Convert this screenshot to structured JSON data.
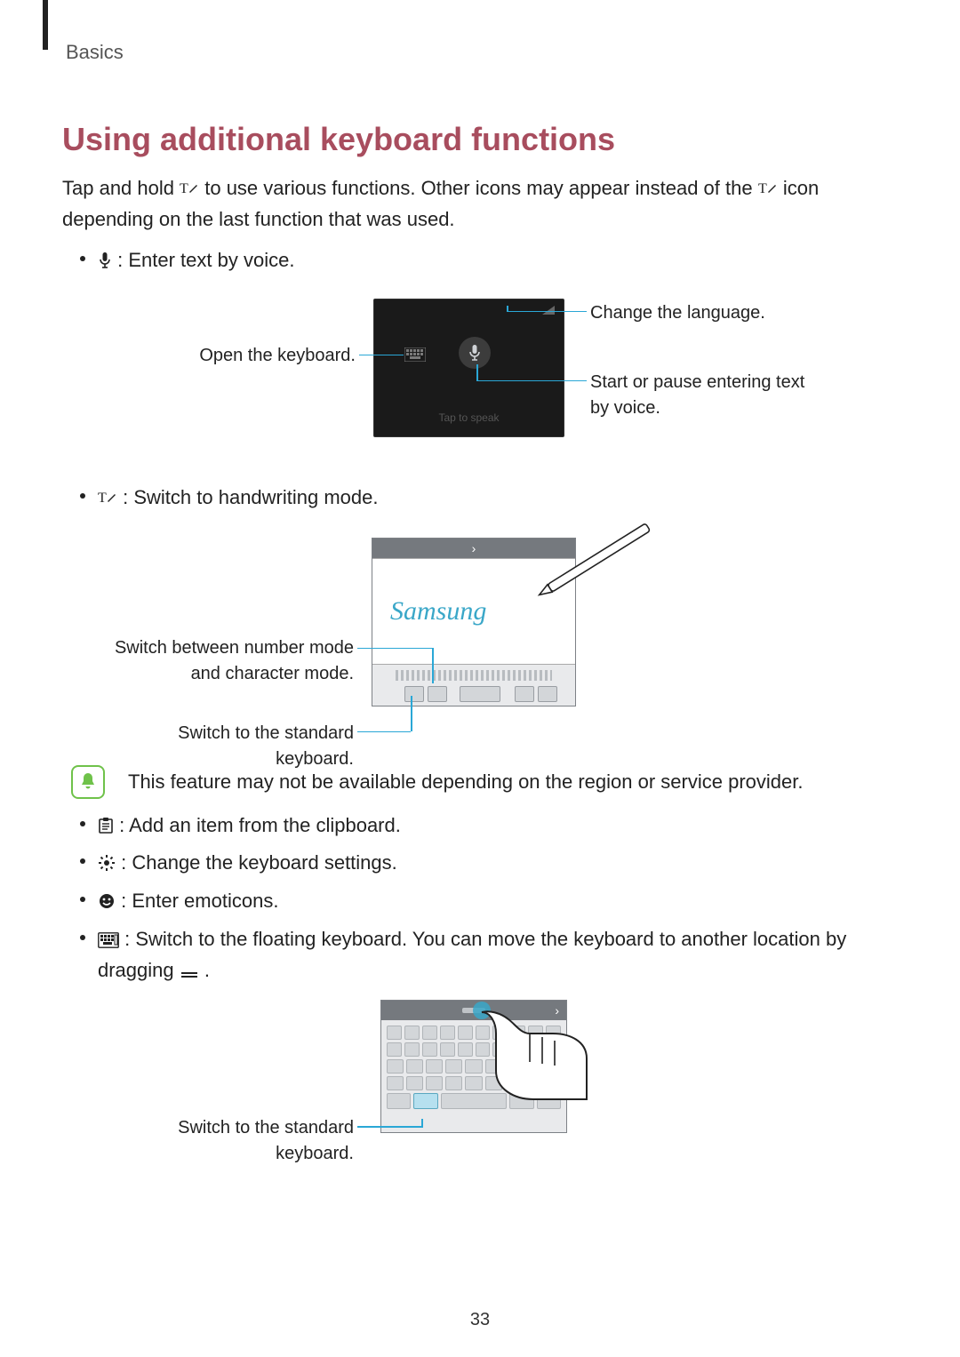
{
  "breadcrumb": "Basics",
  "heading": "Using additional keyboard functions",
  "intro_a": "Tap and hold ",
  "intro_b": " to use various functions. Other icons may appear instead of the ",
  "intro_c": " icon depending on the last function that was used.",
  "bullets_top": {
    "voice": " : Enter text by voice."
  },
  "fig1_callouts": {
    "open_keyboard": "Open the keyboard.",
    "change_language": "Change the language.",
    "start_pause": "Start or pause entering text by voice."
  },
  "voice_panel": {
    "tap_to_speak": "Tap to speak"
  },
  "bullets_mid": {
    "handwriting": " : Switch to handwriting mode."
  },
  "fig2_callouts": {
    "num_char": "Switch between number mode and character mode.",
    "std_kb": "Switch to the standard keyboard."
  },
  "hw_text": "Samsung",
  "note": "This feature may not be available depending on the region or service provider.",
  "bullets_bottom": {
    "clipboard": " : Add an item from the clipboard.",
    "settings": " : Change the keyboard settings.",
    "emoticons": " : Enter emoticons.",
    "floating_a": " : Switch to the floating keyboard. You can move the keyboard to another location by dragging ",
    "floating_b": "."
  },
  "fig3_callouts": {
    "std_kb": "Switch to the standard keyboard."
  },
  "page_number": "33"
}
